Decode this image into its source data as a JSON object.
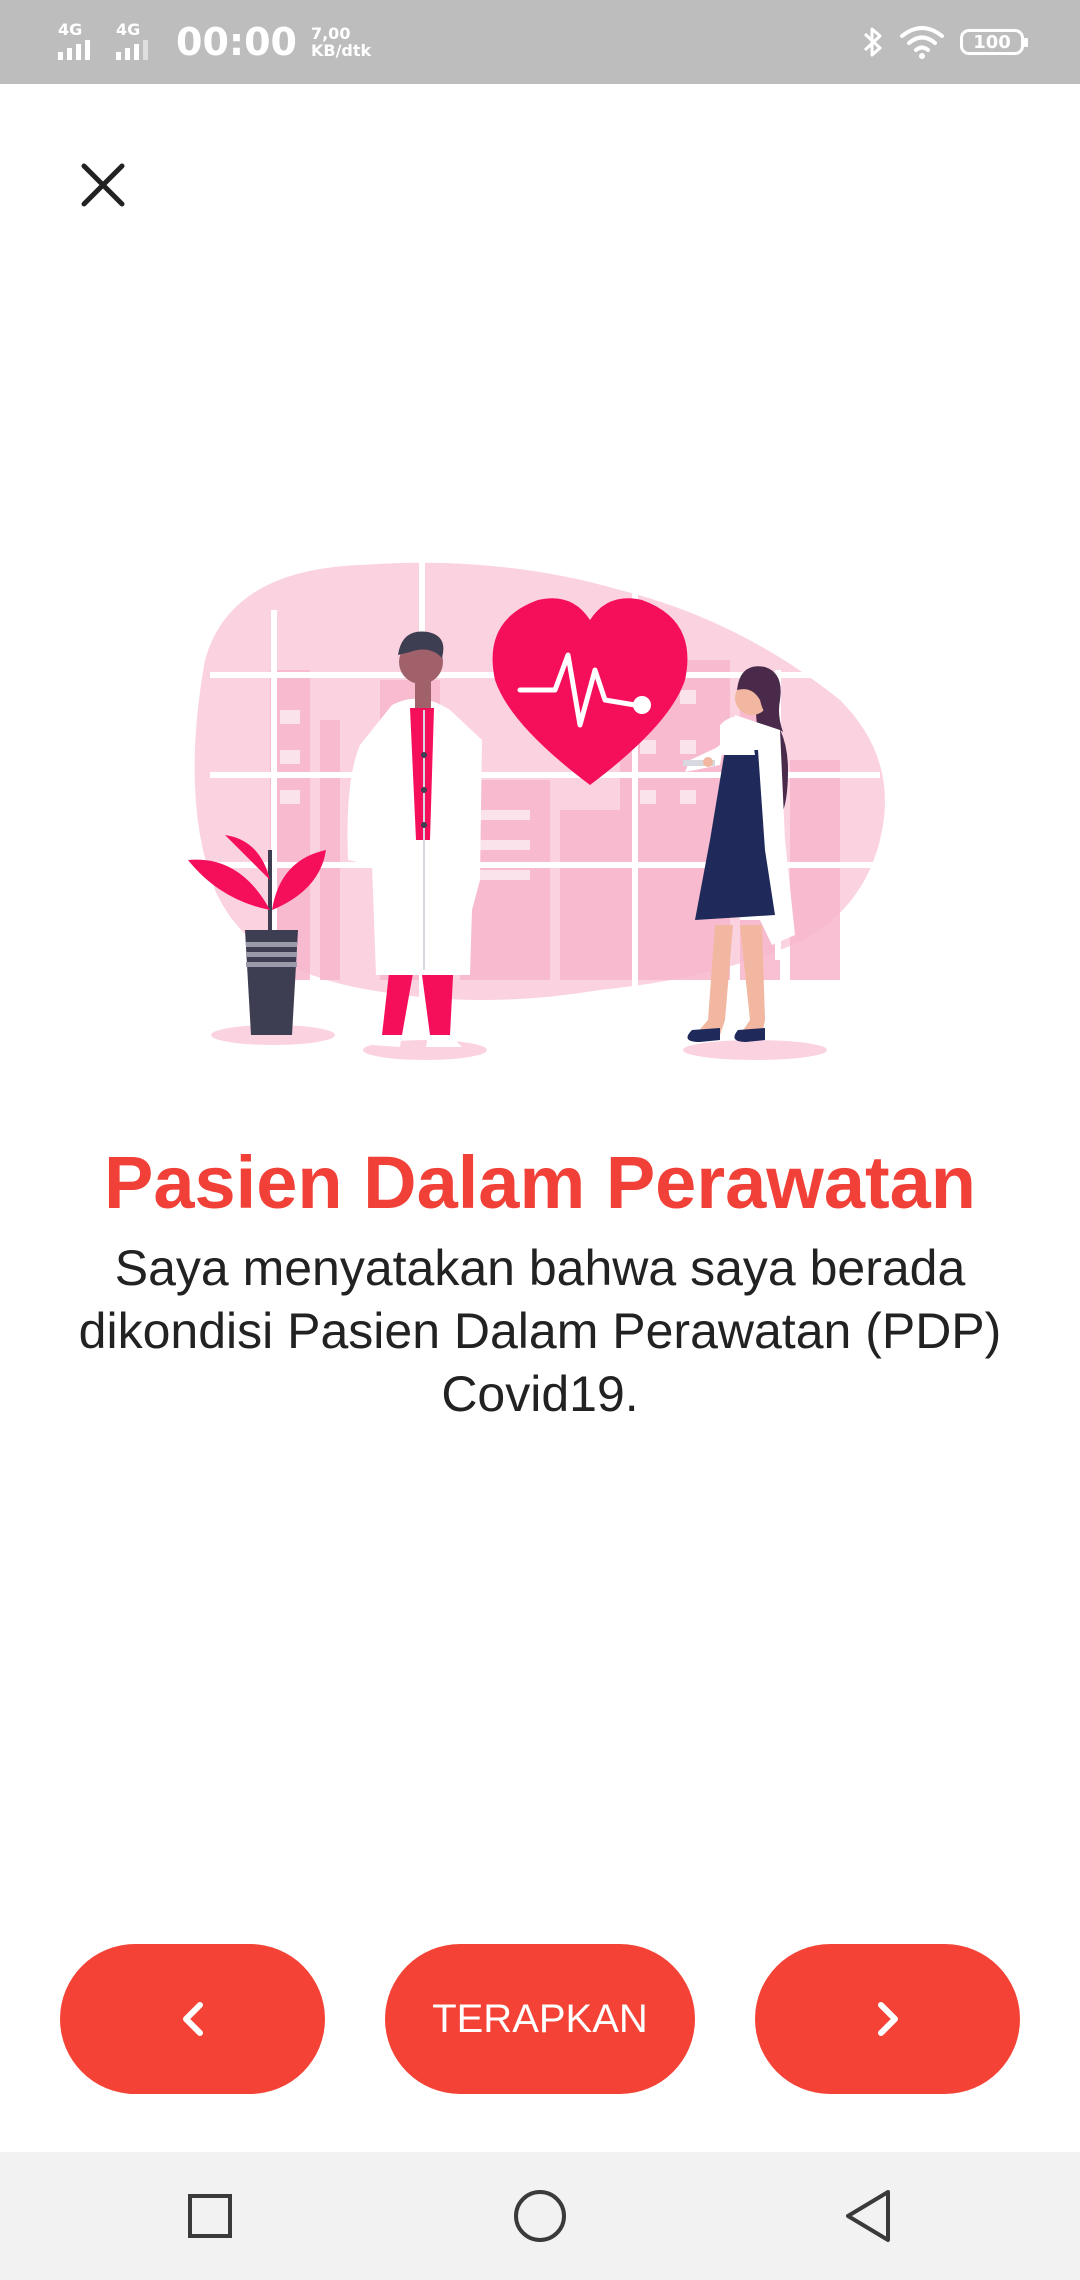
{
  "status_bar": {
    "network_1": "4G",
    "network_2": "4G",
    "time": "00:00",
    "speed_value": "7,00",
    "speed_unit": "KB/dtk",
    "battery": "100"
  },
  "icons": {
    "close": "close-icon",
    "prev": "chevron-left-icon",
    "next": "chevron-right-icon",
    "recent": "square-icon",
    "home": "circle-icon",
    "back": "triangle-back-icon"
  },
  "content": {
    "title": "Pasien Dalam Perawatan",
    "description": "Saya menyatakan bahwa saya berada dikondisi Pasien Dalam Perawatan (PDP) Covid19."
  },
  "buttons": {
    "apply_label": "TERAPKAN"
  },
  "colors": {
    "accent": "#f44336",
    "title": "#f04037",
    "illustration_pink": "#f50f5a"
  }
}
